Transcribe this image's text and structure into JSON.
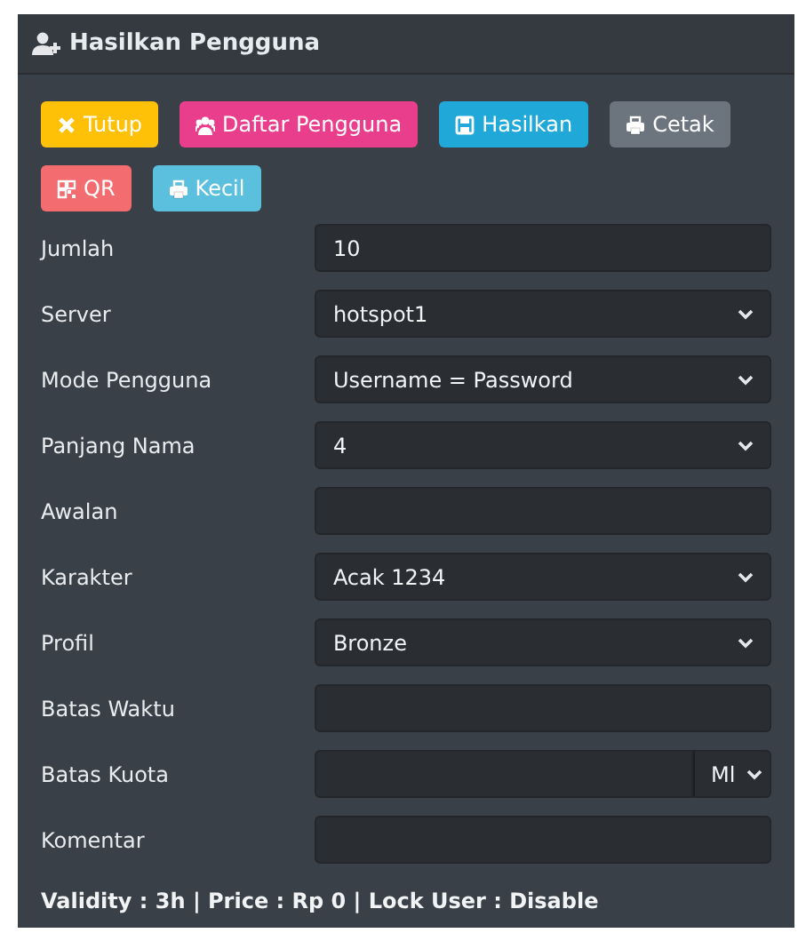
{
  "panel": {
    "title": "Hasilkan Pengguna"
  },
  "buttons": [
    {
      "kind": "close",
      "label": "Tutup",
      "color": "#ffc107"
    },
    {
      "kind": "users",
      "label": "Daftar Pengguna",
      "color": "#e83e8c"
    },
    {
      "kind": "save",
      "label": "Hasilkan",
      "color": "#1fa8d8"
    },
    {
      "kind": "print",
      "label": "Cetak",
      "color": "#6c757d"
    },
    {
      "kind": "qr",
      "label": "QR",
      "color": "#f36c6f"
    },
    {
      "kind": "print",
      "label": "Kecil",
      "color": "#5bc0de"
    }
  ],
  "fields": [
    {
      "kind": "input",
      "label": "Jumlah",
      "value": "10"
    },
    {
      "kind": "select",
      "label": "Server",
      "value": "hotspot1"
    },
    {
      "kind": "select",
      "label": "Mode Pengguna",
      "value": "Username = Password"
    },
    {
      "kind": "select",
      "label": "Panjang Nama",
      "value": "4"
    },
    {
      "kind": "input",
      "label": "Awalan"
    },
    {
      "kind": "select",
      "label": "Karakter",
      "value": "Acak 1234"
    },
    {
      "kind": "select",
      "label": "Profil",
      "value": "Bronze"
    },
    {
      "kind": "input",
      "label": "Batas Waktu"
    },
    {
      "kind": "unit",
      "label": "Batas Kuota",
      "unit": "Ml"
    },
    {
      "kind": "input",
      "label": "Komentar"
    }
  ],
  "summary": "Validity : 3h | Price : Rp 0 | Lock User : Disable"
}
